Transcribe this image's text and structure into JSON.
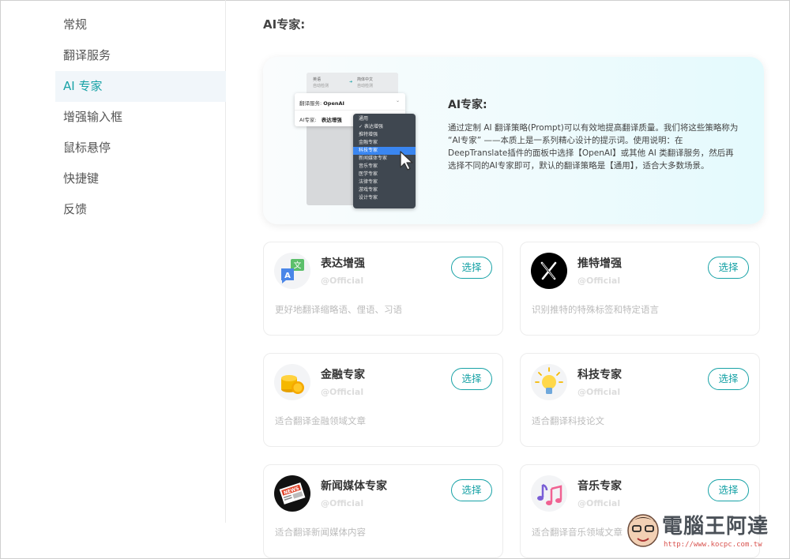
{
  "sidebar": {
    "items": [
      {
        "label": "常规"
      },
      {
        "label": "翻译服务"
      },
      {
        "label": "AI 专家"
      },
      {
        "label": "增强输入框"
      },
      {
        "label": "鼠标悬停"
      },
      {
        "label": "快捷键"
      },
      {
        "label": "反馈"
      }
    ],
    "active_index": 2
  },
  "main": {
    "section_title": "AI专家:",
    "hero": {
      "title": "AI专家:",
      "description": "通过定制 AI 翻译策略(Prompt)可以有效地提高翻译质量。我们将这些策略称为 “AI专家” ——本质上是一系列精心设计的提示词。使用说明：在DeepTranslate插件的面板中选择【OpenAI】或其他 AI 类翻译服务，然后再选择不同的AI专家即可，默认的翻译策略是【通用】，适合大多数场景。",
      "mock": {
        "back_left_top": "英语",
        "back_left_sub": "自动检测",
        "back_right_top": "简体中文",
        "back_right_sub": "自动检测",
        "service_label": "翻译服务:",
        "service_value": "OpenAI",
        "expert_label": "AI专家:",
        "expert_value": "表达增强",
        "dropdown": [
          "通用",
          "✓ 表达增强",
          "推特增强",
          "金融专家",
          "科技专家",
          "新闻媒体专家",
          "音乐专家",
          "医学专家",
          "法律专家",
          "游戏专家",
          "设计专家"
        ],
        "highlight_index": 4
      }
    },
    "cards": [
      {
        "title": "表达增强",
        "author": "@Official",
        "desc": "更好地翻译缩略语、俚语、习语",
        "button": "选择",
        "icon": "translate-bubbles-icon"
      },
      {
        "title": "推特增强",
        "author": "@Official",
        "desc": "识别推特的特殊标签和特定语言",
        "button": "选择",
        "icon": "x-logo-icon"
      },
      {
        "title": "金融专家",
        "author": "@Official",
        "desc": "适合翻译金融领域文章",
        "button": "选择",
        "icon": "gold-coins-icon"
      },
      {
        "title": "科技专家",
        "author": "@Official",
        "desc": "适合翻译科技论文",
        "button": "选择",
        "icon": "light-bulb-icon"
      },
      {
        "title": "新闻媒体专家",
        "author": "@Official",
        "desc": "适合翻译新闻媒体内容",
        "button": "选择",
        "icon": "newspaper-icon"
      },
      {
        "title": "音乐专家",
        "author": "@Official",
        "desc": "适合翻译音乐领域文章",
        "button": "选择",
        "icon": "music-notes-icon"
      }
    ]
  },
  "watermark": {
    "text": "電腦王阿達",
    "url": "http://www.kocpc.com.tw"
  },
  "colors": {
    "accent": "#17a2a6",
    "active_bg": "#f1f6fa",
    "highlight": "#3a86f0"
  }
}
